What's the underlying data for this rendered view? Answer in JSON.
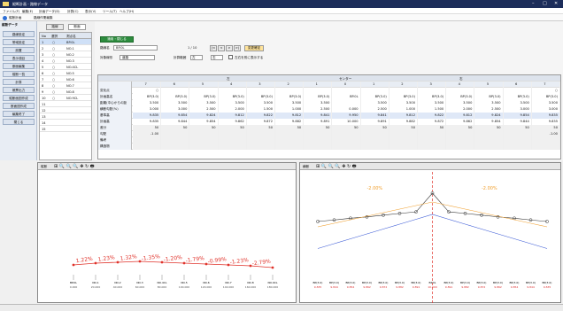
{
  "window": {
    "title": "縦断計画 - 路線データ"
  },
  "menu": [
    "ファイル(F)",
    "編集(E)",
    "計画データ(D)",
    "計算(C)",
    "表示(V)",
    "ツール(T)",
    "ヘルプ(H)"
  ],
  "toolbar": {
    "mode": "縦断計画",
    "tag": "路線作業編集"
  },
  "sidebar": {
    "header": "縦断データ",
    "items": [
      "路線設定",
      "帯域設定",
      "設置",
      "表示項目",
      "断面編集",
      "縦断一覧",
      "計算",
      "帳票出力",
      "縦断面図作成",
      "断面図作成",
      "編集終了",
      "閉じる"
    ]
  },
  "list": {
    "tab1": "路線",
    "tab2": "断面",
    "headers": [
      "No",
      "選択",
      "測点名"
    ],
    "rows": [
      [
        "1",
        "○",
        "BP.0L"
      ],
      [
        "2",
        "○",
        "NO.1"
      ],
      [
        "3",
        "○",
        "NO.2"
      ],
      [
        "4",
        "○",
        "NO.3"
      ],
      [
        "5",
        "○",
        "NO.4CL"
      ],
      [
        "6",
        "○",
        "NO.5"
      ],
      [
        "7",
        "○",
        "NO.6"
      ],
      [
        "8",
        "○",
        "NO.7"
      ],
      [
        "9",
        "○",
        "NO.8"
      ],
      [
        "10",
        "○",
        "NO.9CL"
      ],
      [
        "11",
        "",
        ""
      ],
      [
        "12",
        "",
        ""
      ],
      [
        "13",
        "",
        ""
      ],
      [
        "14",
        "",
        ""
      ],
      [
        "15",
        "",
        ""
      ]
    ]
  },
  "main": {
    "apply_button": "適用・閉じる",
    "route_label": "路線名",
    "route_value": "BP.0L",
    "counter": "1 / 10",
    "prev": "<",
    "next": ">",
    "first": "|<",
    "last": ">|",
    "confirm": "変更確定",
    "section_label": "対象線形",
    "section_value": "道路",
    "range_label": "計算範囲",
    "range_from": "左",
    "range_to": "右",
    "check_label": "左右を別に表示する",
    "group_left": "左",
    "group_center": "センター",
    "group_right": "右",
    "cols_left": [
      "7",
      "6",
      "5",
      "4",
      "3",
      "2",
      "1"
    ],
    "col_center": "0",
    "cols_right": [
      "1",
      "2",
      "3",
      "4",
      "5",
      "6",
      "7"
    ],
    "rows": [
      {
        "label": "変化点",
        "vals": [
          "○",
          "",
          "",
          "",
          "",
          "",
          "",
          "",
          "",
          "",
          "",
          "",
          "",
          "",
          "○"
        ]
      },
      {
        "label": "計画高名",
        "vals": [
          "BP(3.0)",
          "BP(3.0)",
          "BP(3.0)",
          "BP(3.0)",
          "BP(3.0)",
          "BP(3.0)",
          "BP(3.0)",
          "BP.0L",
          "BP(3.0)",
          "BP(3.0)",
          "BP(3.0)",
          "BP(3.0)",
          "BP(3.0)",
          "BP(3.0)",
          "BP(3.0)"
        ]
      },
      {
        "label": "距離(中心からの距離)",
        "vals": [
          "3.500",
          "3.500",
          "3.500",
          "3.500",
          "3.500",
          "3.500",
          "3.500",
          "",
          "3.500",
          "3.500",
          "3.500",
          "3.500",
          "3.500",
          "3.500",
          "3.500"
        ]
      },
      {
        "label": "横断勾配(%)",
        "vals": [
          "3.000",
          "3.000",
          "2.500",
          "2.000",
          "1.500",
          "1.000",
          "2.500",
          "0.000",
          "2.500",
          "1.000",
          "1.500",
          "2.000",
          "2.500",
          "3.000",
          "3.000"
        ]
      },
      {
        "label": "基準高",
        "vals": [
          "9.835",
          "9.854",
          "9.824",
          "9.812",
          "9.822",
          "9.812",
          "9.841",
          "9.950",
          "9.841",
          "9.812",
          "9.822",
          "9.812",
          "9.824",
          "9.854",
          "9.835"
        ]
      },
      {
        "label": "計画高",
        "vals": [
          "9.835",
          "9.844",
          "9.854",
          "9.862",
          "9.872",
          "9.882",
          "9.891",
          "10.000",
          "9.891",
          "9.882",
          "9.872",
          "9.862",
          "9.854",
          "9.844",
          "9.835"
        ]
      },
      {
        "label": "差分",
        "vals": [
          "50",
          "50",
          "50",
          "50",
          "50",
          "50",
          "50",
          "50",
          "50",
          "50",
          "50",
          "50",
          "50",
          "50",
          "50"
        ]
      },
      {
        "label": "勾配",
        "vals": [
          "-1.00",
          "",
          "",
          "",
          "",
          "",
          "",
          "",
          "",
          "",
          "",
          "",
          "",
          "",
          "-1.00"
        ]
      },
      {
        "label": "備考",
        "vals": [
          "",
          "",
          "",
          "",
          "",
          "",
          "",
          "",
          "",
          "",
          "",
          "",
          "",
          "",
          ""
        ]
      },
      {
        "label": "構造物",
        "vals": [
          "",
          "",
          "",
          "",
          "",
          "",
          "",
          "",
          "",
          "",
          "",
          "",
          "",
          "",
          ""
        ]
      }
    ]
  },
  "left_chart": {
    "title": "縦断",
    "labels": [
      "1.22%",
      "1.23%",
      "1.32%",
      "-1.35%",
      "-1.20%",
      "-1.79%",
      "-0.99%",
      "-1.23%",
      "-2.79%"
    ],
    "stations": [
      "BP.0L",
      "NO.1",
      "NO.2",
      "NO.3",
      "NO.4CL",
      "NO.5",
      "NO.6",
      "NO.7",
      "NO.8",
      "NO.9CL"
    ],
    "station_values": [
      "0.000",
      "20.000",
      "40.000",
      "60.000",
      "80.000",
      "100.000",
      "120.000",
      "140.000",
      "160.000",
      "180.000"
    ]
  },
  "right_chart": {
    "title": "横断",
    "left_label": "-2.00%",
    "right_label": "-2.00%",
    "points": [
      "BP(3.0)",
      "BP(3.0)",
      "BP(3.0)",
      "BP(3.0)",
      "BP(3.0)",
      "BP(3.0)",
      "BP(3.0)",
      "BP.0L",
      "BP(3.0)",
      "BP(3.0)",
      "BP(3.0)",
      "BP(3.0)",
      "BP(3.0)",
      "BP(3.0)",
      "BP(3.0)"
    ],
    "values": [
      "9.835",
      "9.844",
      "9.854",
      "9.862",
      "9.872",
      "9.882",
      "9.891",
      "10.000",
      "9.891",
      "9.882",
      "9.872",
      "9.862",
      "9.854",
      "9.844",
      "9.835"
    ]
  },
  "colors": {
    "accent": "#1c2d5a",
    "red": "#e0322a",
    "blue": "#3c5bd6",
    "orange": "#f0a030"
  }
}
